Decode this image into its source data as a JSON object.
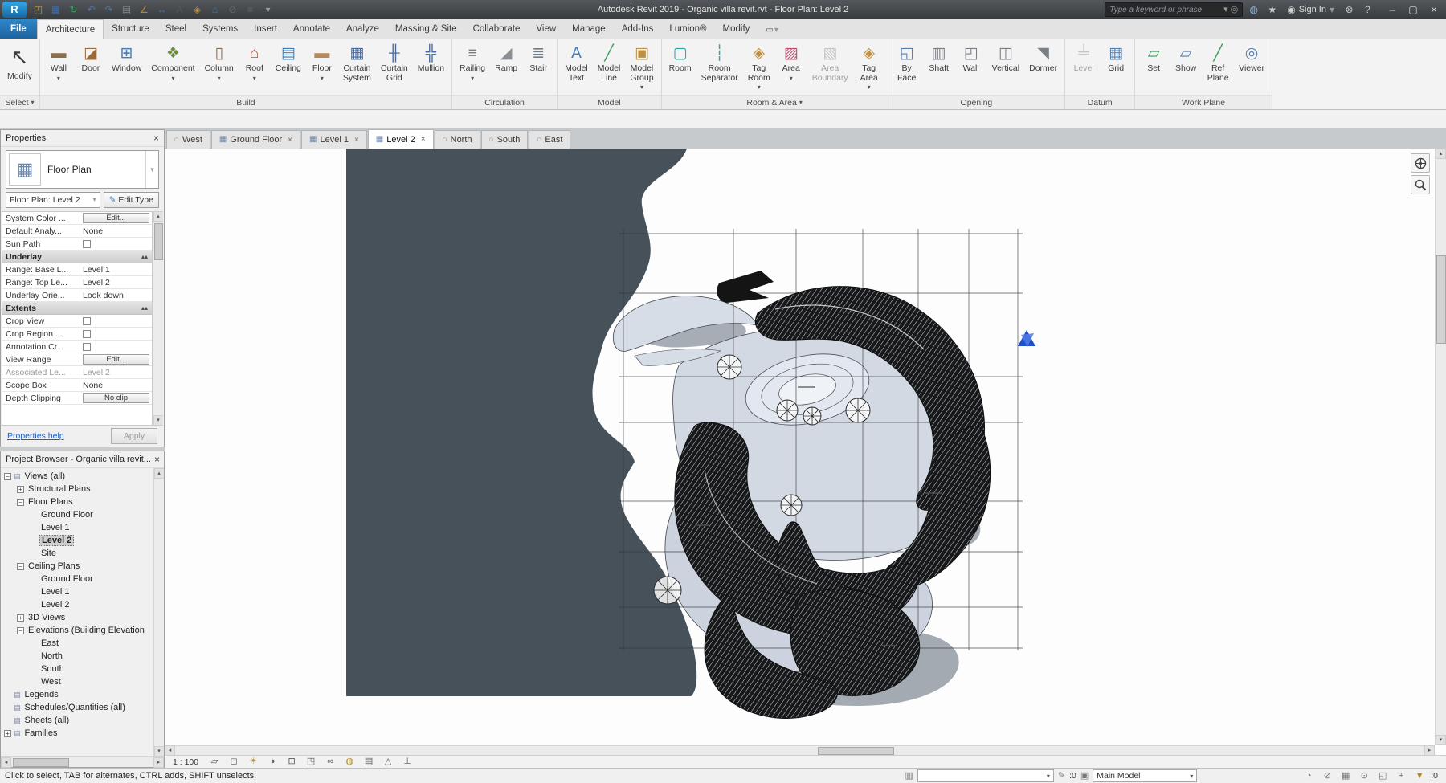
{
  "titlebar": {
    "title": "Autodesk Revit 2019 - Organic villa revit.rvt - Floor Plan: Level 2",
    "search_placeholder": "Type a keyword or phrase",
    "sign_in_label": "Sign In",
    "qat": [
      "revit-logo",
      "open",
      "save",
      "sync",
      "undo",
      "redo",
      "print",
      "measure",
      "aligned-dimension",
      "text-note",
      "tag-by-category",
      "default-3d-view",
      "section",
      "thin-lines",
      "customize"
    ],
    "right_icons": [
      "communication-center",
      "favorites",
      "sign-in",
      "exchange-apps",
      "help"
    ],
    "window_controls": [
      "minimize",
      "maximize",
      "close"
    ]
  },
  "ribbon": {
    "tabs": [
      {
        "label": "File",
        "file": true
      },
      {
        "label": "Architecture",
        "active": true
      },
      {
        "label": "Structure"
      },
      {
        "label": "Steel"
      },
      {
        "label": "Systems"
      },
      {
        "label": "Insert"
      },
      {
        "label": "Annotate"
      },
      {
        "label": "Analyze"
      },
      {
        "label": "Massing & Site"
      },
      {
        "label": "Collaborate"
      },
      {
        "label": "View"
      },
      {
        "label": "Manage"
      },
      {
        "label": "Add-Ins"
      },
      {
        "label": "Lumion®"
      },
      {
        "label": "Modify"
      }
    ],
    "panels": [
      {
        "label": "Select",
        "has_arrow": true,
        "buttons": [
          {
            "label": "Modify",
            "icon": "modify",
            "large": true
          }
        ]
      },
      {
        "label": "Build",
        "buttons": [
          {
            "label": "Wall",
            "icon": "wall",
            "arrow": true
          },
          {
            "label": "Door",
            "icon": "door"
          },
          {
            "label": "Window",
            "icon": "window"
          },
          {
            "label": "Component",
            "icon": "component",
            "arrow": true
          },
          {
            "label": "Column",
            "icon": "column",
            "arrow": true
          },
          {
            "label": "Roof",
            "icon": "roof",
            "arrow": true
          },
          {
            "label": "Ceiling",
            "icon": "ceiling"
          },
          {
            "label": "Floor",
            "icon": "floor",
            "arrow": true
          },
          {
            "label": "Curtain\nSystem",
            "icon": "curtain-system"
          },
          {
            "label": "Curtain\nGrid",
            "icon": "curtain-grid"
          },
          {
            "label": "Mullion",
            "icon": "mullion"
          }
        ]
      },
      {
        "label": "Circulation",
        "buttons": [
          {
            "label": "Railing",
            "icon": "railing",
            "arrow": true
          },
          {
            "label": "Ramp",
            "icon": "ramp"
          },
          {
            "label": "Stair",
            "icon": "stair"
          }
        ]
      },
      {
        "label": "Model",
        "buttons": [
          {
            "label": "Model\nText",
            "icon": "model-text"
          },
          {
            "label": "Model\nLine",
            "icon": "model-line"
          },
          {
            "label": "Model\nGroup",
            "icon": "model-group",
            "arrow": true
          }
        ]
      },
      {
        "label": "Room & Area",
        "has_arrow": true,
        "buttons": [
          {
            "label": "Room",
            "icon": "room"
          },
          {
            "label": "Room\nSeparator",
            "icon": "room-separator"
          },
          {
            "label": "Tag\nRoom",
            "icon": "tag-room",
            "arrow": true
          },
          {
            "label": "Area",
            "icon": "area",
            "arrow": true
          },
          {
            "label": "Area\nBoundary",
            "icon": "area-boundary",
            "disabled": true
          },
          {
            "label": "Tag\nArea",
            "icon": "tag-area",
            "arrow": true
          }
        ]
      },
      {
        "label": "Opening",
        "buttons": [
          {
            "label": "By\nFace",
            "icon": "by-face"
          },
          {
            "label": "Shaft",
            "icon": "shaft"
          },
          {
            "label": "Wall",
            "icon": "wall-opening"
          },
          {
            "label": "Vertical",
            "icon": "vertical"
          },
          {
            "label": "Dormer",
            "icon": "dormer"
          }
        ]
      },
      {
        "label": "Datum",
        "buttons": [
          {
            "label": "Level",
            "icon": "level",
            "disabled": true
          },
          {
            "label": "Grid",
            "icon": "grid"
          }
        ]
      },
      {
        "label": "Work Plane",
        "buttons": [
          {
            "label": "Set",
            "icon": "set"
          },
          {
            "label": "Show",
            "icon": "show"
          },
          {
            "label": "Ref\nPlane",
            "icon": "ref-plane"
          },
          {
            "label": "Viewer",
            "icon": "viewer"
          }
        ]
      }
    ]
  },
  "properties": {
    "header": "Properties",
    "type_label": "Floor Plan",
    "instance_selector": "Floor Plan: Level 2",
    "edit_type_label": "Edit Type",
    "rows": [
      {
        "label": "System Color ...",
        "value": "Edit...",
        "kind": "button"
      },
      {
        "label": "Default Analy...",
        "value": "None"
      },
      {
        "label": "Sun Path",
        "kind": "checkbox",
        "checked": false
      },
      {
        "label": "Underlay",
        "kind": "section"
      },
      {
        "label": "Range: Base L...",
        "value": "Level 1"
      },
      {
        "label": "Range: Top Le...",
        "value": "Level 2"
      },
      {
        "label": "Underlay Orie...",
        "value": "Look down"
      },
      {
        "label": "Extents",
        "kind": "section"
      },
      {
        "label": "Crop View",
        "kind": "checkbox",
        "checked": false
      },
      {
        "label": "Crop Region ...",
        "kind": "checkbox",
        "checked": false
      },
      {
        "label": "Annotation Cr...",
        "kind": "checkbox",
        "checked": false
      },
      {
        "label": "View Range",
        "value": "Edit...",
        "kind": "button"
      },
      {
        "label": "Associated Le...",
        "value": "Level 2",
        "disabled": true
      },
      {
        "label": "Scope Box",
        "value": "None"
      },
      {
        "label": "Depth Clipping",
        "value": "No clip",
        "kind": "button"
      }
    ],
    "help_link": "Properties help",
    "apply_label": "Apply"
  },
  "project_browser": {
    "header": "Project Browser - Organic villa revit...",
    "tree": [
      {
        "label": "Views (all)",
        "level": 0,
        "expander": "minus",
        "icon": true
      },
      {
        "label": "Structural Plans",
        "level": 1,
        "expander": "plus"
      },
      {
        "label": "Floor Plans",
        "level": 1,
        "expander": "minus"
      },
      {
        "label": "Ground Floor",
        "level": 2
      },
      {
        "label": "Level 1",
        "level": 2
      },
      {
        "label": "Level 2",
        "level": 2,
        "selected": true
      },
      {
        "label": "Site",
        "level": 2
      },
      {
        "label": "Ceiling Plans",
        "level": 1,
        "expander": "minus"
      },
      {
        "label": "Ground Floor",
        "level": 2
      },
      {
        "label": "Level 1",
        "level": 2
      },
      {
        "label": "Level 2",
        "level": 2
      },
      {
        "label": "3D Views",
        "level": 1,
        "expander": "plus"
      },
      {
        "label": "Elevations (Building Elevation",
        "level": 1,
        "expander": "minus"
      },
      {
        "label": "East",
        "level": 2
      },
      {
        "label": "North",
        "level": 2
      },
      {
        "label": "South",
        "level": 2
      },
      {
        "label": "West",
        "level": 2
      },
      {
        "label": "Legends",
        "level": 0,
        "icon": true
      },
      {
        "label": "Schedules/Quantities (all)",
        "level": 0,
        "icon": true
      },
      {
        "label": "Sheets (all)",
        "level": 0,
        "icon": true
      },
      {
        "label": "Families",
        "level": 0,
        "expander": "plus",
        "icon": true
      }
    ]
  },
  "view_tabs": [
    {
      "label": "West",
      "kind": "elevation"
    },
    {
      "label": "Ground Floor",
      "kind": "plan",
      "closable": true
    },
    {
      "label": "Level 1",
      "kind": "plan",
      "closable": true
    },
    {
      "label": "Level 2",
      "kind": "plan",
      "closable": true,
      "active": true
    },
    {
      "label": "North",
      "kind": "elevation"
    },
    {
      "label": "South",
      "kind": "elevation"
    },
    {
      "label": "East",
      "kind": "elevation"
    }
  ],
  "view_control_bar": {
    "scale": "1 : 100",
    "icons": [
      "detail-level",
      "visual-style",
      "sun-path",
      "shadows",
      "crop-view",
      "show-crop-region",
      "temporary-hide-isolate",
      "reveal-hidden-elements",
      "temporary-view-properties",
      "show-analytical-model",
      "reveal-constraints"
    ]
  },
  "status_bar": {
    "hint": "Click to select, TAB for alternates, CTRL adds, SHIFT unselects.",
    "editable_count": ":0",
    "design_option": "Main Model",
    "filter_count": ":0",
    "right_icons": [
      "background-processes",
      "select-links",
      "select-underlay",
      "select-pinned",
      "select-by-face",
      "drag-on-selection",
      "filter"
    ]
  }
}
